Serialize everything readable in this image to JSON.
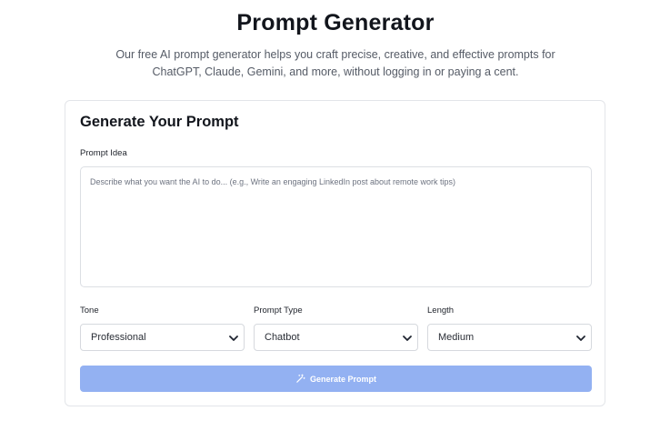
{
  "header": {
    "title": "Prompt Generator",
    "subtitle": "Our free AI prompt generator helps you craft precise, creative, and effective prompts for ChatGPT, Claude, Gemini, and more, without logging in or paying a cent."
  },
  "form": {
    "title": "Generate Your Prompt",
    "prompt_idea": {
      "label": "Prompt Idea",
      "placeholder": "Describe what you want the AI to do... (e.g., Write an engaging LinkedIn post about remote work tips)",
      "value": ""
    },
    "tone": {
      "label": "Tone",
      "selected": "Professional"
    },
    "prompt_type": {
      "label": "Prompt Type",
      "selected": "Chatbot"
    },
    "length": {
      "label": "Length",
      "selected": "Medium"
    },
    "generate_button": {
      "label": "Generate Prompt",
      "icon": "magic-wand-icon"
    }
  },
  "colors": {
    "button_bg": "#93b1f2",
    "border": "#dcdfe4",
    "title": "#12151c",
    "subtitle": "#555b66"
  }
}
